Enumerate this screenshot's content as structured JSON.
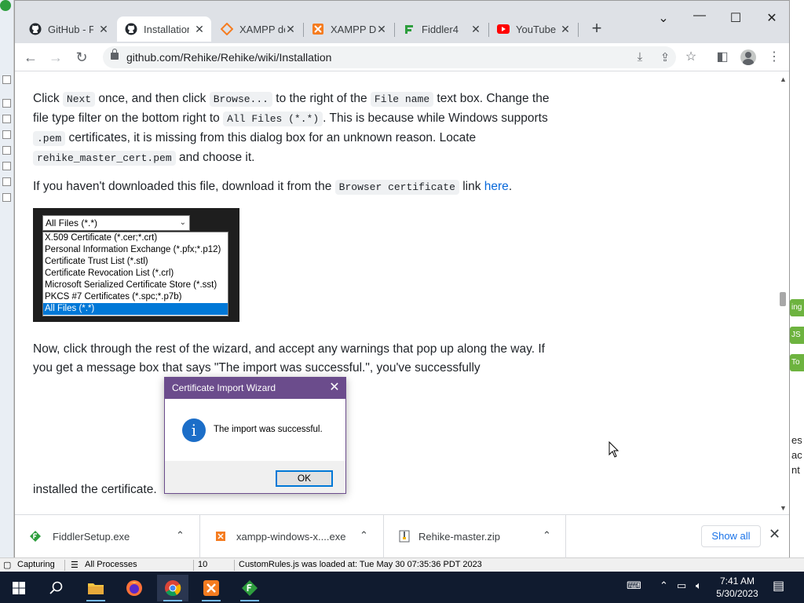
{
  "browser": {
    "tabs": [
      {
        "label": "GitHub - F",
        "icon": "github-icon",
        "active": false
      },
      {
        "label": "Installation",
        "icon": "github-icon",
        "active": true
      },
      {
        "label": "XAMPP do",
        "icon": "xampp-diamond-icon",
        "active": false
      },
      {
        "label": "XAMPP Do",
        "icon": "xampp-icon",
        "active": false
      },
      {
        "label": "Fiddler4",
        "icon": "fiddler-icon",
        "active": false
      },
      {
        "label": "YouTube",
        "icon": "youtube-icon",
        "active": false
      }
    ],
    "url": "github.com/Rehike/Rehike/wiki/Installation"
  },
  "content": {
    "p1": {
      "t1": "Click ",
      "c1": "Next",
      "t2": " once, and then click ",
      "c2": "Browse...",
      "t3": " to the right of the ",
      "c3": "File name",
      "t4": " text box. Change the file type filter on the bottom right to ",
      "c4": "All Files (*.*)",
      "t5": ". This is because while Windows supports ",
      "c5": ".pem",
      "t6": " certificates, it is missing from this dialog box for an unknown reason. Locate ",
      "c6": "rehike_master_cert.pem",
      "t7": " and choose it."
    },
    "p2": {
      "t1": "If you haven't downloaded this file, download it from the ",
      "c1": "Browser certificate",
      "t2": " link ",
      "link": "here",
      "t3": "."
    },
    "dropdown": {
      "selected": "All Files (*.*)",
      "options": [
        "X.509 Certificate (*.cer;*.crt)",
        "Personal Information Exchange (*.pfx;*.p12)",
        "Certificate Trust List (*.stl)",
        "Certificate Revocation List (*.crl)",
        "Microsoft Serialized Certificate Store (*.sst)",
        "PKCS #7 Certificates (*.spc;*.p7b)",
        "All Files (*.*)"
      ]
    },
    "p3": "Now, click through the rest of the wizard, and accept any warnings that pop up along the way. If you get a message box that says \"The import was successful.\", you've successfully",
    "p4": "installed the certificate."
  },
  "dialog": {
    "title": "Certificate Import Wizard",
    "message": "The import was successful.",
    "ok": "OK",
    "info_glyph": "i"
  },
  "downloads": {
    "items": [
      {
        "name": "FiddlerSetup.exe",
        "icon": "fiddler-file-icon"
      },
      {
        "name": "xampp-windows-x....exe",
        "icon": "xampp-file-icon"
      },
      {
        "name": "Rehike-master.zip",
        "icon": "zip-file-icon"
      }
    ],
    "show_all": "Show all"
  },
  "fiddler_status": {
    "capturing": "Capturing",
    "processes": "All Processes",
    "count": "10",
    "message": "CustomRules.js was loaded at: Tue May 30 07:35:36 PDT 2023"
  },
  "background_right": {
    "tab1": "ing",
    "tab2": "JS",
    "tab3": "To",
    "text1": "es",
    "text2": "ac",
    "text3": "nt"
  },
  "taskbar": {
    "time": "7:41 AM",
    "date": "5/30/2023"
  },
  "colors": {
    "dialog_title": "#6b4c8c",
    "link": "#0969da",
    "taskbar": "#101b2f",
    "selection": "#0078d7"
  }
}
